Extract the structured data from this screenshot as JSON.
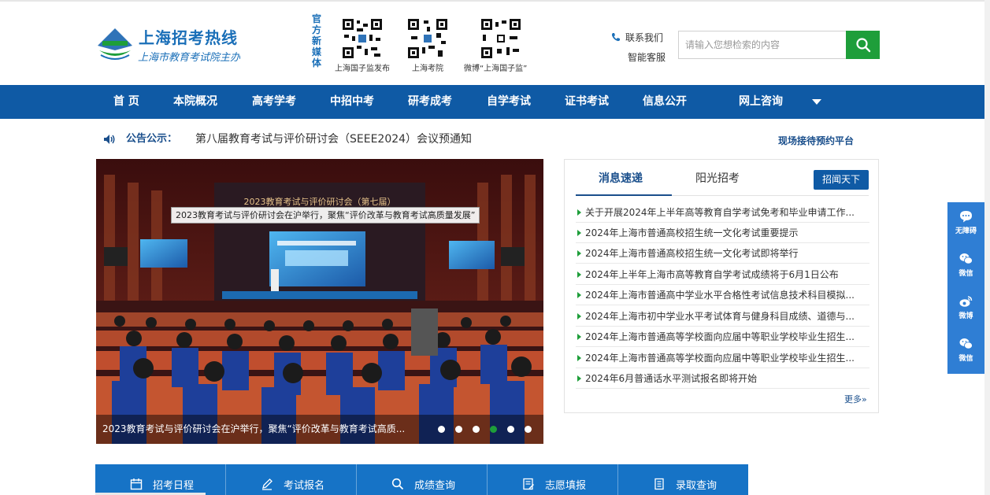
{
  "header": {
    "logo_title": "上海招考热线",
    "logo_subtitle": "上海市教育考试院主办",
    "media_label": "官方新媒体",
    "qr_codes": [
      {
        "label": "上海国子监发布",
        "icon": "qr-code-icon"
      },
      {
        "label": "上海考院",
        "icon": "qr-code-icon"
      },
      {
        "label": "微博“上海国子监”",
        "icon": "qr-code-icon"
      }
    ],
    "contact_label": "联系我们",
    "service_label": "智能客服",
    "search_placeholder": "请输入您想检索的内容",
    "search_button_icon": "search-icon",
    "search_button_color": "#1e9e3a"
  },
  "nav": {
    "color": "#0f5aa5",
    "items": [
      "首 页",
      "本院概况",
      "高考学考",
      "中招中考",
      "研考成考",
      "自学考试",
      "证书考试",
      "信息公开",
      "网上咨询"
    ]
  },
  "notice": {
    "label": "公告公示：",
    "text": "第八届教育考试与评价研讨会（SEEE2024）会议预通知",
    "reserve_link": "现场接待预约平台"
  },
  "banner": {
    "overlay_caption": "2023教育考试与评价研讨会在沪举行，聚焦“评价改革与教育考试高质量发展”",
    "stage_title": "2023教育考试与评价研讨会（第七届）",
    "caption": "2023教育考试与评价研讨会在沪举行，聚焦“评价改革与教育考试高质...",
    "slide_count": 6,
    "active_slide": 4
  },
  "news": {
    "tabs": [
      "消息速递",
      "阳光招考"
    ],
    "button": "招闻天下",
    "items": [
      "关于开展2024年上半年高等教育自学考试免考和毕业申请工作...",
      "2024年上海市普通高校招生统一文化考试重要提示",
      "2024年上海市普通高校招生统一文化考试即将举行",
      "2024年上半年上海市高等教育自学考试成绩将于6月1日公布",
      "2024年上海市普通高中学业水平合格性考试信息技术科目模拟...",
      "2024年上海市初中学业水平考试体育与健身科目成绩、道德与...",
      "2024年上海市普通高等学校面向应届中等职业学校毕业生招生...",
      "2024年上海市普通高等学校面向应届中等职业学校毕业生招生...",
      "2024年6月普通话水平测试报名即将开始"
    ],
    "more": "更多»"
  },
  "quick_links": [
    {
      "label": "招考日程",
      "icon": "calendar-icon"
    },
    {
      "label": "考试报名",
      "icon": "pencil-icon"
    },
    {
      "label": "成绩查询",
      "icon": "search-icon"
    },
    {
      "label": "志愿填报",
      "icon": "form-icon"
    },
    {
      "label": "录取查询",
      "icon": "document-icon"
    }
  ],
  "float_bar": [
    {
      "label": "无障碍",
      "icon": "chat-bubble-icon"
    },
    {
      "label": "微信",
      "icon": "wechat-icon"
    },
    {
      "label": "微博",
      "icon": "weibo-icon"
    },
    {
      "label": "微信",
      "icon": "wechat-icon"
    }
  ]
}
